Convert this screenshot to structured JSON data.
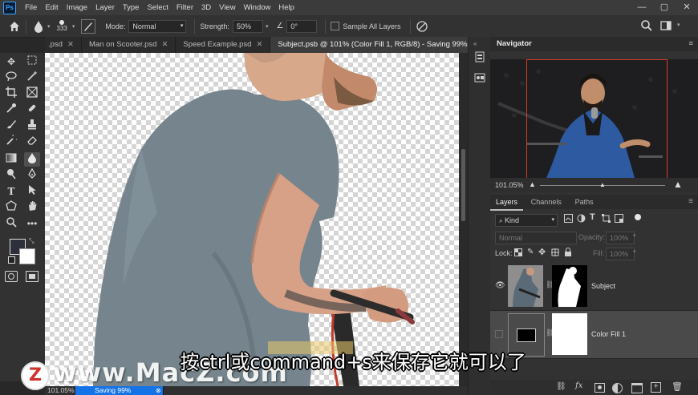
{
  "app": {
    "logo_text": "Ps"
  },
  "menu": [
    "File",
    "Edit",
    "Image",
    "Layer",
    "Type",
    "Select",
    "Filter",
    "3D",
    "View",
    "Window",
    "Help"
  ],
  "window_controls": {
    "minimize": "—",
    "maximize": "▢",
    "close": "✕"
  },
  "options_bar": {
    "brush_size": "333",
    "mode_label": "Mode:",
    "mode_value": "Normal",
    "strength_label": "Strength:",
    "strength_value": "50%",
    "angle_value": "0°",
    "sample_all_layers": "Sample All Layers",
    "sample_all_checked": false
  },
  "tabs": [
    {
      "label": ".psd",
      "active": false
    },
    {
      "label": "Man on Scooter.psd",
      "active": false
    },
    {
      "label": "Speed Example.psd",
      "active": false
    },
    {
      "label": "Subject.psb @ 101% (Color Fill 1, RGB/8) - Saving 99%",
      "active": true
    }
  ],
  "tab_overflow": "»",
  "status": {
    "zoom": "101.05%",
    "progress_text": "Saving 99%",
    "progress": 0.99
  },
  "navigator": {
    "title": "Navigator",
    "zoom": "101.05%"
  },
  "layers_panel": {
    "tabs": [
      "Layers",
      "Channels",
      "Paths"
    ],
    "active_tab": "Layers",
    "filter_label": "Kind",
    "blend_mode": "Normal",
    "opacity_label": "Opacity:",
    "opacity_value": "100%",
    "lock_label": "Lock:",
    "fill_label": "Fill:",
    "fill_value": "100%",
    "layers": [
      {
        "name": "Subject",
        "visible": true,
        "selected": false
      },
      {
        "name": "Color Fill 1",
        "visible": false,
        "selected": true
      }
    ]
  },
  "subtitle": "按ctrl或command+s来保存它就可以了",
  "watermark": {
    "logo": "Z",
    "site": "www.MacZ.com"
  },
  "colors": {
    "accent": "#31a8ff",
    "progress": "#1473e6",
    "panel": "#323232",
    "selected_layer": "#4a4a4a"
  }
}
